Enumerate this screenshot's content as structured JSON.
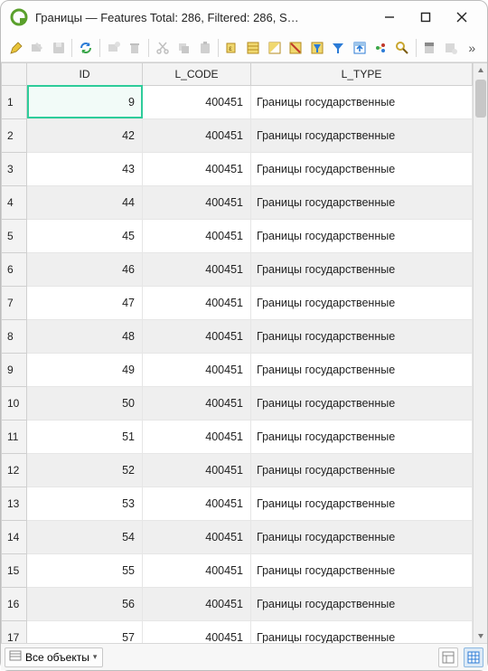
{
  "window": {
    "title": "Границы — Features Total: 286, Filtered: 286, S…"
  },
  "columns": {
    "c0": "",
    "c1": "ID",
    "c2": "L_CODE",
    "c3": "L_TYPE"
  },
  "rows": [
    {
      "n": "1",
      "id": "9",
      "code": "400451",
      "type": "Границы государственные",
      "selected": true
    },
    {
      "n": "2",
      "id": "42",
      "code": "400451",
      "type": "Границы государственные"
    },
    {
      "n": "3",
      "id": "43",
      "code": "400451",
      "type": "Границы государственные"
    },
    {
      "n": "4",
      "id": "44",
      "code": "400451",
      "type": "Границы государственные"
    },
    {
      "n": "5",
      "id": "45",
      "code": "400451",
      "type": "Границы государственные"
    },
    {
      "n": "6",
      "id": "46",
      "code": "400451",
      "type": "Границы государственные"
    },
    {
      "n": "7",
      "id": "47",
      "code": "400451",
      "type": "Границы государственные"
    },
    {
      "n": "8",
      "id": "48",
      "code": "400451",
      "type": "Границы государственные"
    },
    {
      "n": "9",
      "id": "49",
      "code": "400451",
      "type": "Границы государственные"
    },
    {
      "n": "10",
      "id": "50",
      "code": "400451",
      "type": "Границы государственные"
    },
    {
      "n": "11",
      "id": "51",
      "code": "400451",
      "type": "Границы государственные"
    },
    {
      "n": "12",
      "id": "52",
      "code": "400451",
      "type": "Границы государственные"
    },
    {
      "n": "13",
      "id": "53",
      "code": "400451",
      "type": "Границы государственные"
    },
    {
      "n": "14",
      "id": "54",
      "code": "400451",
      "type": "Границы государственные"
    },
    {
      "n": "15",
      "id": "55",
      "code": "400451",
      "type": "Границы государственные"
    },
    {
      "n": "16",
      "id": "56",
      "code": "400451",
      "type": "Границы государственные"
    },
    {
      "n": "17",
      "id": "57",
      "code": "400451",
      "type": "Границы государственные"
    }
  ],
  "status": {
    "filter_label": "Все объекты"
  },
  "toolbar_icons": [
    "pencil-icon",
    "multi-edit-icon",
    "save-icon",
    "refresh-icon",
    "add-feature-icon",
    "delete-feature-icon",
    "cut-icon",
    "copy-icon",
    "paste-icon",
    "expr-select-icon",
    "select-all-icon",
    "invert-select-icon",
    "deselect-icon",
    "filter-icon",
    "filter-form-icon",
    "pan-to-icon",
    "zoom-to-icon",
    "field-calc-icon",
    "conditional-format-icon",
    "dock-icon"
  ],
  "icon_colors": {
    "pencil": "#caa23a",
    "disabled": "#b8b8b8",
    "refresh_a": "#2b7bd6",
    "refresh_b": "#3aa64a",
    "yellow": "#e7c33a",
    "filter": "#2b7bd6",
    "zoom": "#c9a62e",
    "dots": "#2b7bd6"
  }
}
